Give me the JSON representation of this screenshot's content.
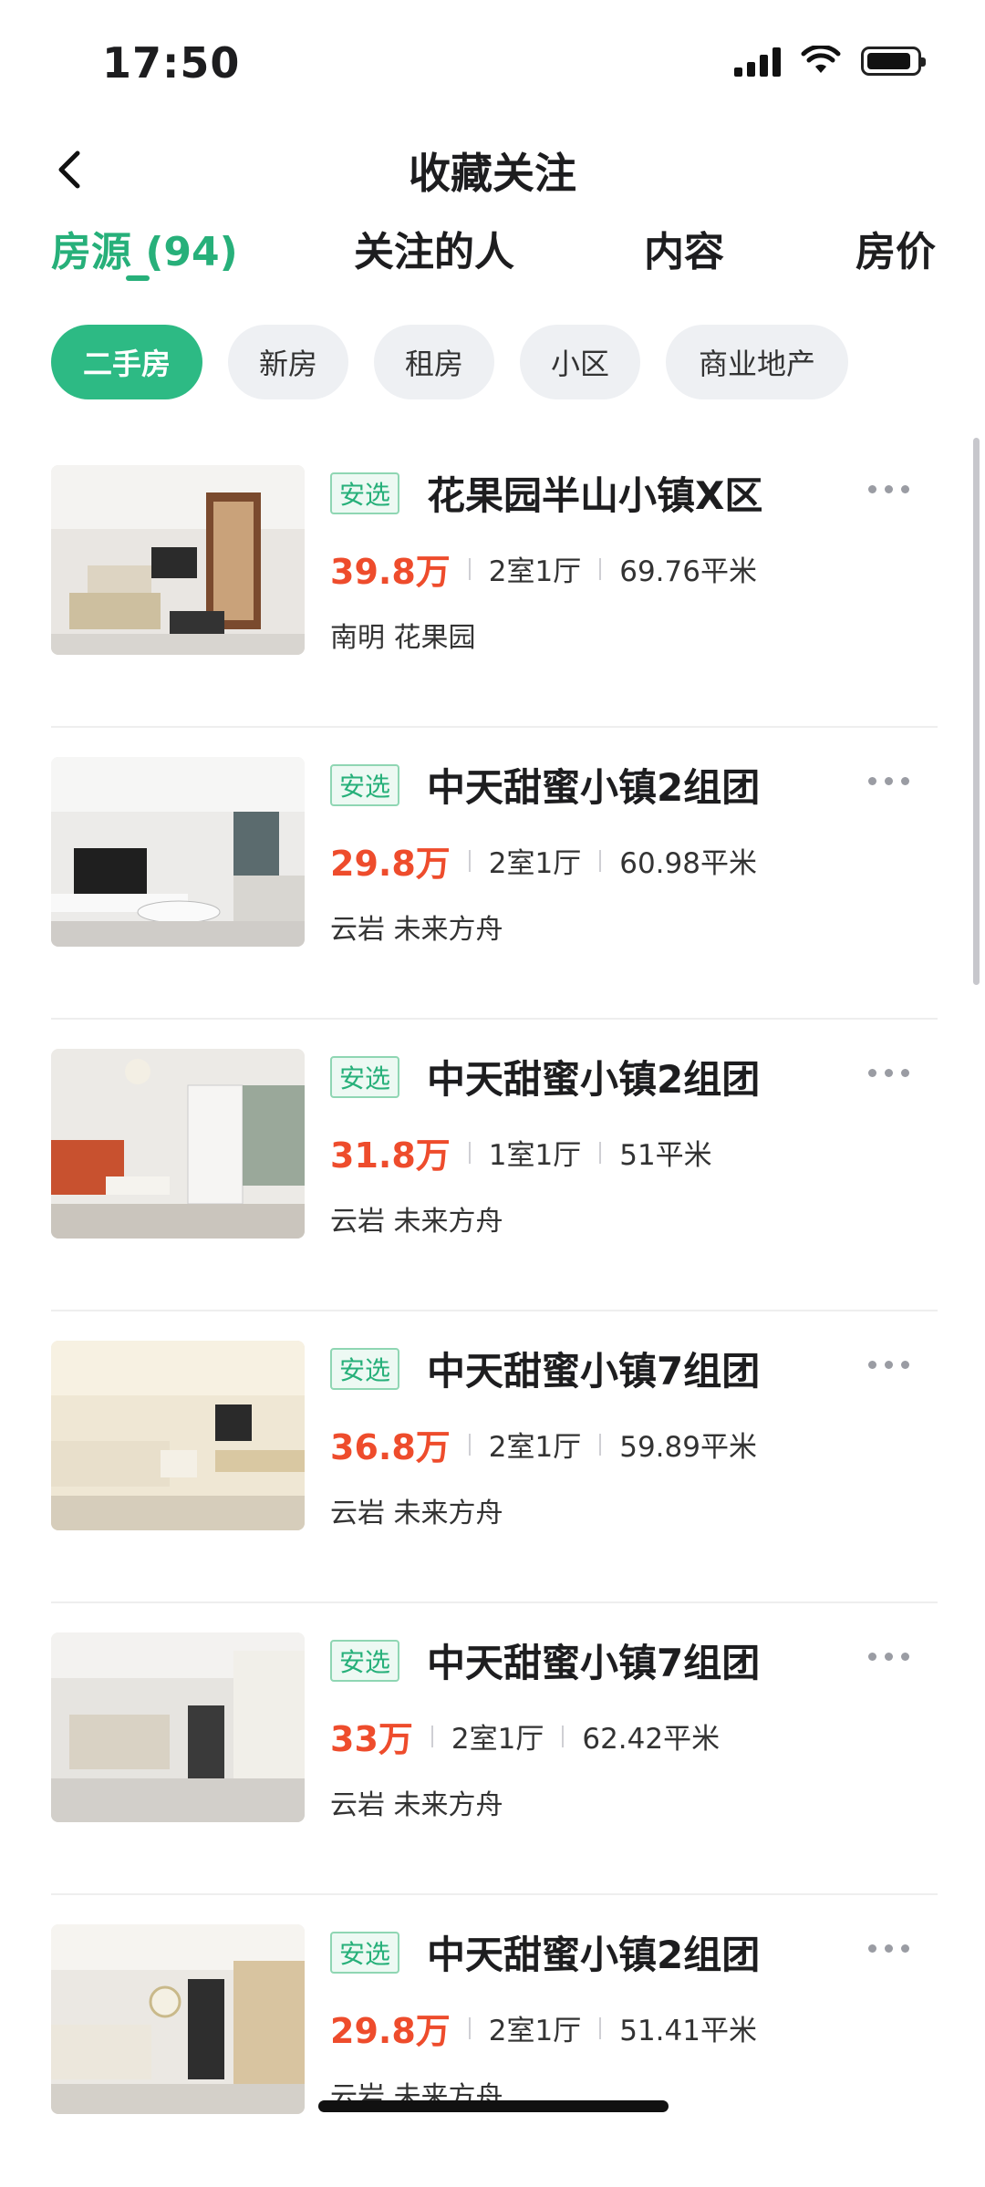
{
  "status_bar": {
    "time": "17:50"
  },
  "header": {
    "title": "收藏关注"
  },
  "tabs": [
    {
      "label": "房源 (94)",
      "active": true
    },
    {
      "label": "关注的人",
      "active": false
    },
    {
      "label": "内容",
      "active": false
    },
    {
      "label": "房价",
      "active": false
    }
  ],
  "filters": [
    {
      "label": "二手房",
      "active": true
    },
    {
      "label": "新房",
      "active": false
    },
    {
      "label": "租房",
      "active": false
    },
    {
      "label": "小区",
      "active": false
    },
    {
      "label": "商业地产",
      "active": false
    }
  ],
  "listings": [
    {
      "badge": "安选",
      "title": "花果园半山小镇Ⅹ区",
      "price": "39.8万",
      "layout": "2室1厅",
      "area": "69.76平米",
      "location": "南明 花果园"
    },
    {
      "badge": "安选",
      "title": "中天甜蜜小镇2组团",
      "price": "29.8万",
      "layout": "2室1厅",
      "area": "60.98平米",
      "location": "云岩 未来方舟"
    },
    {
      "badge": "安选",
      "title": "中天甜蜜小镇2组团",
      "price": "31.8万",
      "layout": "1室1厅",
      "area": "51平米",
      "location": "云岩 未来方舟"
    },
    {
      "badge": "安选",
      "title": "中天甜蜜小镇7组团",
      "price": "36.8万",
      "layout": "2室1厅",
      "area": "59.89平米",
      "location": "云岩 未来方舟"
    },
    {
      "badge": "安选",
      "title": "中天甜蜜小镇7组团",
      "price": "33万",
      "layout": "2室1厅",
      "area": "62.42平米",
      "location": "云岩 未来方舟"
    },
    {
      "badge": "安选",
      "title": "中天甜蜜小镇2组团",
      "price": "29.8万",
      "layout": "2室1厅",
      "area": "51.41平米",
      "location": "云岩 未来方舟"
    }
  ],
  "colors": {
    "accent": "#27b07a",
    "price": "#ee4c2c",
    "chip_bg": "#eef0f3"
  },
  "icons": {
    "back": "chevron-left-icon",
    "more": "more-horizontal-icon",
    "wifi": "wifi-icon",
    "battery": "battery-icon",
    "signal": "signal-icon"
  }
}
